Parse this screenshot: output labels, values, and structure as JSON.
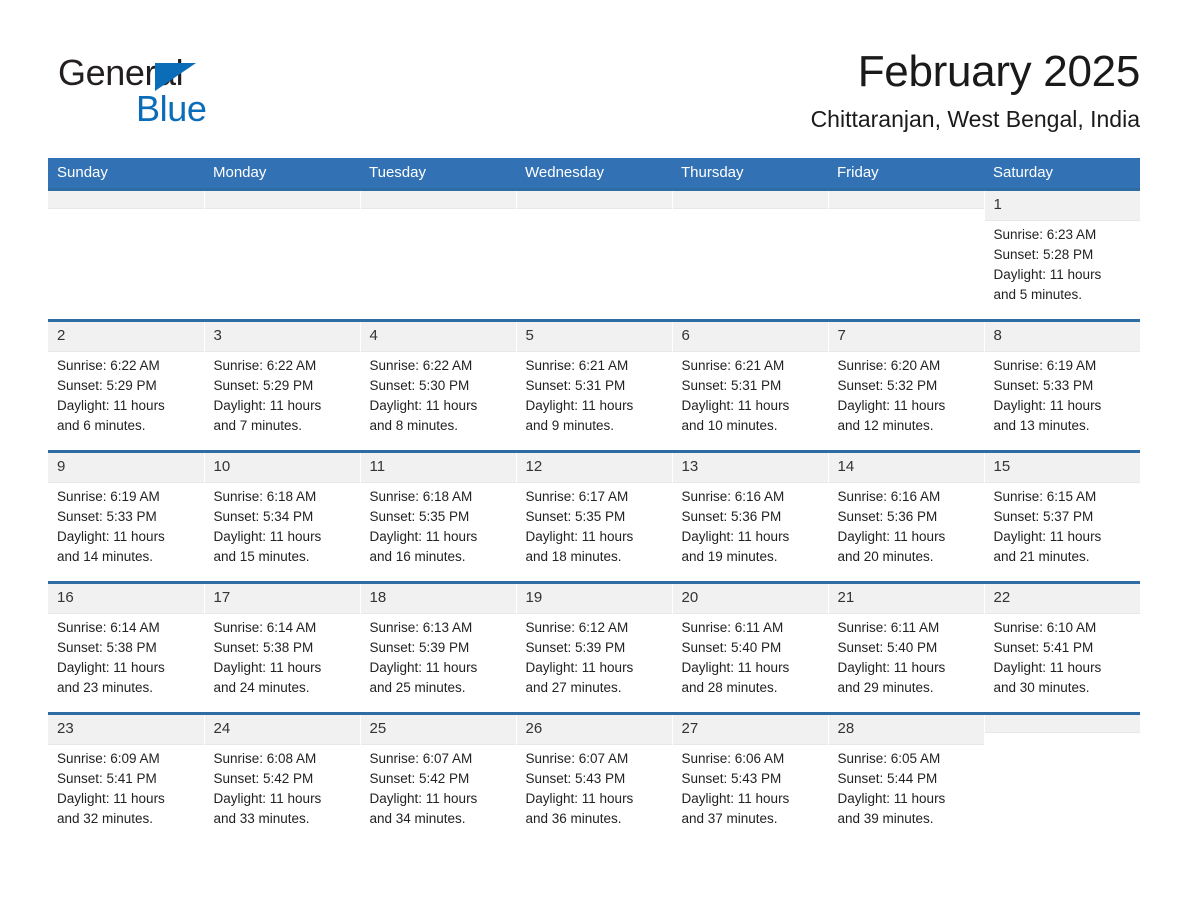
{
  "brand": {
    "name_part1": "General",
    "name_part2": "Blue",
    "triangle_icon": "blue-triangle-icon",
    "accent_color": "#0b6cb8"
  },
  "header": {
    "month_title": "February 2025",
    "location": "Chittaranjan, West Bengal, India"
  },
  "theme": {
    "header_blue": "#3272b4",
    "row_border_blue": "#2e6da4",
    "daynum_band": "#f1f1f1"
  },
  "weekday_headers": [
    "Sunday",
    "Monday",
    "Tuesday",
    "Wednesday",
    "Thursday",
    "Friday",
    "Saturday"
  ],
  "weeks": [
    [
      {
        "day": "",
        "empty": true,
        "sunrise": "",
        "sunset": "",
        "daylight_line1": "",
        "daylight_line2": ""
      },
      {
        "day": "",
        "empty": true,
        "sunrise": "",
        "sunset": "",
        "daylight_line1": "",
        "daylight_line2": ""
      },
      {
        "day": "",
        "empty": true,
        "sunrise": "",
        "sunset": "",
        "daylight_line1": "",
        "daylight_line2": ""
      },
      {
        "day": "",
        "empty": true,
        "sunrise": "",
        "sunset": "",
        "daylight_line1": "",
        "daylight_line2": ""
      },
      {
        "day": "",
        "empty": true,
        "sunrise": "",
        "sunset": "",
        "daylight_line1": "",
        "daylight_line2": ""
      },
      {
        "day": "",
        "empty": true,
        "sunrise": "",
        "sunset": "",
        "daylight_line1": "",
        "daylight_line2": ""
      },
      {
        "day": "1",
        "empty": false,
        "sunrise": "Sunrise: 6:23 AM",
        "sunset": "Sunset: 5:28 PM",
        "daylight_line1": "Daylight: 11 hours",
        "daylight_line2": "and 5 minutes."
      }
    ],
    [
      {
        "day": "2",
        "empty": false,
        "sunrise": "Sunrise: 6:22 AM",
        "sunset": "Sunset: 5:29 PM",
        "daylight_line1": "Daylight: 11 hours",
        "daylight_line2": "and 6 minutes."
      },
      {
        "day": "3",
        "empty": false,
        "sunrise": "Sunrise: 6:22 AM",
        "sunset": "Sunset: 5:29 PM",
        "daylight_line1": "Daylight: 11 hours",
        "daylight_line2": "and 7 minutes."
      },
      {
        "day": "4",
        "empty": false,
        "sunrise": "Sunrise: 6:22 AM",
        "sunset": "Sunset: 5:30 PM",
        "daylight_line1": "Daylight: 11 hours",
        "daylight_line2": "and 8 minutes."
      },
      {
        "day": "5",
        "empty": false,
        "sunrise": "Sunrise: 6:21 AM",
        "sunset": "Sunset: 5:31 PM",
        "daylight_line1": "Daylight: 11 hours",
        "daylight_line2": "and 9 minutes."
      },
      {
        "day": "6",
        "empty": false,
        "sunrise": "Sunrise: 6:21 AM",
        "sunset": "Sunset: 5:31 PM",
        "daylight_line1": "Daylight: 11 hours",
        "daylight_line2": "and 10 minutes."
      },
      {
        "day": "7",
        "empty": false,
        "sunrise": "Sunrise: 6:20 AM",
        "sunset": "Sunset: 5:32 PM",
        "daylight_line1": "Daylight: 11 hours",
        "daylight_line2": "and 12 minutes."
      },
      {
        "day": "8",
        "empty": false,
        "sunrise": "Sunrise: 6:19 AM",
        "sunset": "Sunset: 5:33 PM",
        "daylight_line1": "Daylight: 11 hours",
        "daylight_line2": "and 13 minutes."
      }
    ],
    [
      {
        "day": "9",
        "empty": false,
        "sunrise": "Sunrise: 6:19 AM",
        "sunset": "Sunset: 5:33 PM",
        "daylight_line1": "Daylight: 11 hours",
        "daylight_line2": "and 14 minutes."
      },
      {
        "day": "10",
        "empty": false,
        "sunrise": "Sunrise: 6:18 AM",
        "sunset": "Sunset: 5:34 PM",
        "daylight_line1": "Daylight: 11 hours",
        "daylight_line2": "and 15 minutes."
      },
      {
        "day": "11",
        "empty": false,
        "sunrise": "Sunrise: 6:18 AM",
        "sunset": "Sunset: 5:35 PM",
        "daylight_line1": "Daylight: 11 hours",
        "daylight_line2": "and 16 minutes."
      },
      {
        "day": "12",
        "empty": false,
        "sunrise": "Sunrise: 6:17 AM",
        "sunset": "Sunset: 5:35 PM",
        "daylight_line1": "Daylight: 11 hours",
        "daylight_line2": "and 18 minutes."
      },
      {
        "day": "13",
        "empty": false,
        "sunrise": "Sunrise: 6:16 AM",
        "sunset": "Sunset: 5:36 PM",
        "daylight_line1": "Daylight: 11 hours",
        "daylight_line2": "and 19 minutes."
      },
      {
        "day": "14",
        "empty": false,
        "sunrise": "Sunrise: 6:16 AM",
        "sunset": "Sunset: 5:36 PM",
        "daylight_line1": "Daylight: 11 hours",
        "daylight_line2": "and 20 minutes."
      },
      {
        "day": "15",
        "empty": false,
        "sunrise": "Sunrise: 6:15 AM",
        "sunset": "Sunset: 5:37 PM",
        "daylight_line1": "Daylight: 11 hours",
        "daylight_line2": "and 21 minutes."
      }
    ],
    [
      {
        "day": "16",
        "empty": false,
        "sunrise": "Sunrise: 6:14 AM",
        "sunset": "Sunset: 5:38 PM",
        "daylight_line1": "Daylight: 11 hours",
        "daylight_line2": "and 23 minutes."
      },
      {
        "day": "17",
        "empty": false,
        "sunrise": "Sunrise: 6:14 AM",
        "sunset": "Sunset: 5:38 PM",
        "daylight_line1": "Daylight: 11 hours",
        "daylight_line2": "and 24 minutes."
      },
      {
        "day": "18",
        "empty": false,
        "sunrise": "Sunrise: 6:13 AM",
        "sunset": "Sunset: 5:39 PM",
        "daylight_line1": "Daylight: 11 hours",
        "daylight_line2": "and 25 minutes."
      },
      {
        "day": "19",
        "empty": false,
        "sunrise": "Sunrise: 6:12 AM",
        "sunset": "Sunset: 5:39 PM",
        "daylight_line1": "Daylight: 11 hours",
        "daylight_line2": "and 27 minutes."
      },
      {
        "day": "20",
        "empty": false,
        "sunrise": "Sunrise: 6:11 AM",
        "sunset": "Sunset: 5:40 PM",
        "daylight_line1": "Daylight: 11 hours",
        "daylight_line2": "and 28 minutes."
      },
      {
        "day": "21",
        "empty": false,
        "sunrise": "Sunrise: 6:11 AM",
        "sunset": "Sunset: 5:40 PM",
        "daylight_line1": "Daylight: 11 hours",
        "daylight_line2": "and 29 minutes."
      },
      {
        "day": "22",
        "empty": false,
        "sunrise": "Sunrise: 6:10 AM",
        "sunset": "Sunset: 5:41 PM",
        "daylight_line1": "Daylight: 11 hours",
        "daylight_line2": "and 30 minutes."
      }
    ],
    [
      {
        "day": "23",
        "empty": false,
        "sunrise": "Sunrise: 6:09 AM",
        "sunset": "Sunset: 5:41 PM",
        "daylight_line1": "Daylight: 11 hours",
        "daylight_line2": "and 32 minutes."
      },
      {
        "day": "24",
        "empty": false,
        "sunrise": "Sunrise: 6:08 AM",
        "sunset": "Sunset: 5:42 PM",
        "daylight_line1": "Daylight: 11 hours",
        "daylight_line2": "and 33 minutes."
      },
      {
        "day": "25",
        "empty": false,
        "sunrise": "Sunrise: 6:07 AM",
        "sunset": "Sunset: 5:42 PM",
        "daylight_line1": "Daylight: 11 hours",
        "daylight_line2": "and 34 minutes."
      },
      {
        "day": "26",
        "empty": false,
        "sunrise": "Sunrise: 6:07 AM",
        "sunset": "Sunset: 5:43 PM",
        "daylight_line1": "Daylight: 11 hours",
        "daylight_line2": "and 36 minutes."
      },
      {
        "day": "27",
        "empty": false,
        "sunrise": "Sunrise: 6:06 AM",
        "sunset": "Sunset: 5:43 PM",
        "daylight_line1": "Daylight: 11 hours",
        "daylight_line2": "and 37 minutes."
      },
      {
        "day": "28",
        "empty": false,
        "sunrise": "Sunrise: 6:05 AM",
        "sunset": "Sunset: 5:44 PM",
        "daylight_line1": "Daylight: 11 hours",
        "daylight_line2": "and 39 minutes."
      },
      {
        "day": "",
        "empty": true,
        "sunrise": "",
        "sunset": "",
        "daylight_line1": "",
        "daylight_line2": ""
      }
    ]
  ]
}
